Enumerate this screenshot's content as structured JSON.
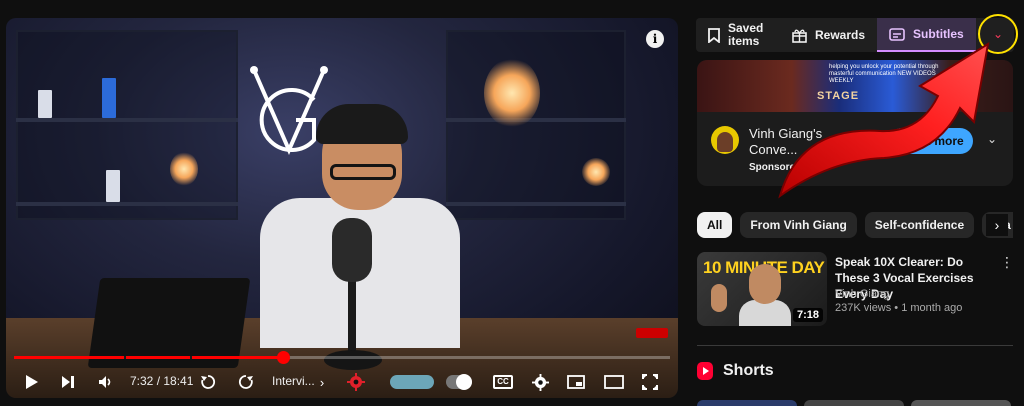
{
  "player": {
    "time_current": "7:32",
    "time_total": "18:41",
    "time_display": "7:32 / 18:41",
    "chapter_label": "Intervi...",
    "progress_fraction": 0.41,
    "icons": [
      "play-icon",
      "next-icon",
      "volume-icon",
      "rewind-icon",
      "forward-icon",
      "settings-icon",
      "cc-icon",
      "miniplayer-icon",
      "theater-icon",
      "fullscreen-icon",
      "info-icon"
    ],
    "cc_label": "CC"
  },
  "tabs": [
    {
      "label": "Saved items",
      "icon": "bookmark-icon"
    },
    {
      "label": "Rewards",
      "icon": "gift-icon"
    },
    {
      "label": "Subtitles",
      "icon": "subtitles-icon",
      "active": true
    }
  ],
  "ad": {
    "banner_stage": "STAGE",
    "banner_tagline": "helping you unlock your potential through masterful communication NEW VIDEOS WEEKLY",
    "title": "Vinh Giang's Conve...",
    "sponsored": "Sponsored ·",
    "cta": "Learn more"
  },
  "chips": [
    {
      "label": "All",
      "active": true
    },
    {
      "label": "From Vinh Giang"
    },
    {
      "label": "Self-confidence"
    },
    {
      "label": "Dia"
    }
  ],
  "video": {
    "thumb_text": "10 MINUTE DAY",
    "duration": "7:18",
    "title": "Speak 10X Clearer: Do These 3 Vocal Exercises Every Day",
    "channel": "Vinh Giang",
    "meta": "237K views • 1 month ago"
  },
  "shorts": {
    "title": "Shorts"
  },
  "colors": {
    "accent_red": "#ff0000",
    "tab_active": "#d38cff",
    "cta_blue": "#3ea6ff",
    "highlight_circle": "#ffe100"
  }
}
